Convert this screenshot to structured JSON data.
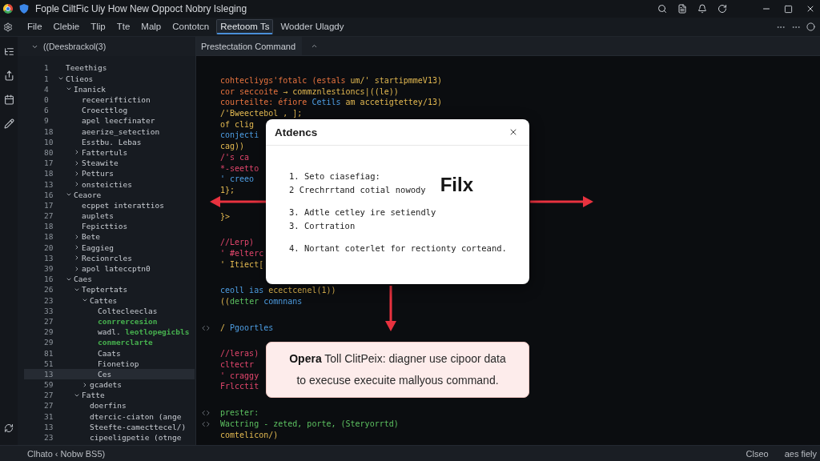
{
  "window": {
    "title": "Fople CiltFic Uiy How New Oppoct Nobry Isleging"
  },
  "menu": [
    {
      "label": "File",
      "selected": false
    },
    {
      "label": "Clebie",
      "selected": false
    },
    {
      "label": "Tlip",
      "selected": false
    },
    {
      "label": "Tte",
      "selected": false
    },
    {
      "label": "Malp",
      "selected": false
    },
    {
      "label": "Contotcn",
      "selected": false
    },
    {
      "label": "Reetoom Ts",
      "selected": true
    },
    {
      "label": "Wodder Ulagdy",
      "selected": false
    }
  ],
  "sidebar": {
    "header": "((Deesbrackol(3)",
    "expanded": true,
    "tree": [
      {
        "number": "1",
        "label": "Teeethigs",
        "selected": false
      },
      {
        "number": "1",
        "label": "Clieos",
        "expanded": true,
        "selected": false,
        "children": [
          {
            "number": "4",
            "label": "Inanick",
            "expanded": true,
            "selected": false,
            "children": [
              {
                "number": "0",
                "label": "receeriftiction",
                "selected": false
              },
              {
                "number": "6",
                "label": "Croecttlog",
                "selected": false
              },
              {
                "number": "9",
                "label": "apel leecfinater",
                "selected": false
              },
              {
                "number": "18",
                "label": "aeerize_setection",
                "selected": false
              },
              {
                "number": "10",
                "label": "Esstbu. Lebas",
                "selected": false
              },
              {
                "number": "80",
                "label": "Fattertuls",
                "expanded": false,
                "selected": false
              },
              {
                "number": "17",
                "label": "Steawite",
                "expanded": false,
                "selected": false
              },
              {
                "number": "18",
                "label": "Petturs",
                "expanded": false,
                "selected": false
              },
              {
                "number": "13",
                "label": "onsteicties",
                "expanded": false,
                "selected": false
              }
            ]
          },
          {
            "number": "16",
            "label": "Ceaore",
            "expanded": true,
            "selected": false,
            "children": [
              {
                "number": "17",
                "label": "ecppet interattios",
                "selected": false
              },
              {
                "number": "27",
                "label": "auplets",
                "selected": false
              },
              {
                "number": "18",
                "label": "Fepicttios",
                "selected": false
              },
              {
                "number": "18",
                "label": "Bete",
                "expanded": false,
                "selected": false
              },
              {
                "number": "20",
                "label": "Eaggieg",
                "expanded": false,
                "selected": false
              },
              {
                "number": "13",
                "label": "Recionrcles",
                "expanded": false,
                "selected": false
              },
              {
                "number": "39",
                "label": "apol lateccptn0",
                "expanded": false,
                "selected": false
              }
            ]
          },
          {
            "number": "16",
            "label": "Caes",
            "expanded": true,
            "selected": false,
            "children": [
              {
                "number": "26",
                "label": "Teptertats",
                "expanded": true,
                "selected": false,
                "children": [
                  {
                    "number": "23",
                    "label": "Cattes",
                    "expanded": true,
                    "selected": false,
                    "children": [
                      {
                        "number": "33",
                        "label": "Coltecleeclas",
                        "selected": false
                      },
                      {
                        "number": "27",
                        "label": "conrrercesion",
                        "color": "#46b04e",
                        "selected": false
                      },
                      {
                        "number": "29",
                        "prefix": "wadl.",
                        "label": "leotlopegicbls",
                        "color": "#46b04e",
                        "selected": false
                      },
                      {
                        "number": "29",
                        "label": "conmerclarte",
                        "color": "#46b04e",
                        "selected": false
                      },
                      {
                        "number": "81",
                        "label": "Caats",
                        "selected": false
                      },
                      {
                        "number": "51",
                        "label": "Fionetiop",
                        "selected": false
                      },
                      {
                        "number": "13",
                        "label": "Ces",
                        "selected": true
                      }
                    ]
                  },
                  {
                    "number": "59",
                    "label": "gcadets",
                    "expanded": false,
                    "selected": false
                  }
                ]
              },
              {
                "number": "27",
                "label": "Fatte",
                "expanded": true,
                "selected": false,
                "children": [
                  {
                    "number": "27",
                    "label": "doerfins",
                    "selected": false
                  },
                  {
                    "number": "31",
                    "label": "dtercic-ciaton (ange",
                    "selected": false
                  },
                  {
                    "number": "13",
                    "label": "Steefte-camecttecel/)",
                    "selected": false
                  },
                  {
                    "number": "23",
                    "label": "cipeeligpetie (otnge",
                    "selected": false
                  }
                ]
              }
            ]
          }
        ]
      }
    ]
  },
  "editor": {
    "tab": "Prestectation Command",
    "blocks": [
      {
        "lines": [
          {
            "segments": [
              {
                "text": "cohtecliygs'fotalc (estals ",
                "kind": "keyword"
              },
              {
                "text": "um/' startipmmeV13)",
                "kind": "string"
              }
            ]
          },
          {
            "segments": [
              {
                "text": "cor seccoite ",
                "kind": "keyword"
              },
              {
                "text": "→ commznlestioncs|((le))",
                "kind": "string"
              }
            ]
          },
          {
            "segments": [
              {
                "text": "courteilte: éfiore ",
                "kind": "keyword"
              },
              {
                "text": "Cetils ",
                "kind": "variable"
              },
              {
                "text": "am accetigtettey/13)",
                "kind": "string"
              }
            ]
          },
          {
            "segments": [
              {
                "text": "/'Bweectebol , ];",
                "kind": "string"
              }
            ]
          },
          {
            "segments": [
              {
                "text": "of clig",
                "kind": "string"
              }
            ]
          },
          {
            "segments": [
              {
                "text": "conjecti",
                "kind": "variable"
              }
            ]
          },
          {
            "segments": [
              {
                "text": "cag))",
                "kind": "string"
              }
            ]
          },
          {
            "segments": [
              {
                "text": "/'s ca",
                "kind": "comment"
              }
            ]
          },
          {
            "segments": [
              {
                "text": "*-seetto",
                "kind": "comment"
              }
            ]
          },
          {
            "segments": [
              {
                "text": "' creeo",
                "kind": "variable"
              }
            ]
          },
          {
            "segments": [
              {
                "text": "1};",
                "kind": "string"
              }
            ]
          }
        ]
      },
      {
        "lines": [
          {
            "segments": [
              {
                "text": "}>",
                "kind": "string"
              }
            ]
          }
        ]
      },
      {
        "lines": [
          {
            "segments": [
              {
                "text": "//Lerp)",
                "kind": "comment"
              }
            ]
          },
          {
            "segments": [
              {
                "text": "' #elterc",
                "kind": "comment"
              }
            ]
          },
          {
            "segments": [
              {
                "text": "' Itiect[",
                "kind": "string"
              }
            ]
          }
        ]
      },
      {
        "lines": [
          {
            "segments": [
              {
                "text": "ceoll ias ",
                "kind": "variable"
              },
              {
                "text": "ecectcenel(1))",
                "kind": "string"
              }
            ]
          },
          {
            "segments": [
              {
                "text": "((",
                "kind": "string"
              },
              {
                "text": "detter ",
                "kind": "function"
              },
              {
                "text": "comnnans",
                "kind": "variable"
              }
            ]
          }
        ]
      },
      {
        "lines": [
          {
            "marker": true,
            "segments": [
              {
                "text": "/ ",
                "kind": "string"
              },
              {
                "text": "Pgoortles",
                "kind": "variable"
              }
            ]
          }
        ]
      },
      {
        "lines": [
          {
            "segments": [
              {
                "text": "//leras)",
                "kind": "comment"
              }
            ]
          },
          {
            "segments": [
              {
                "text": "cltectr",
                "kind": "comment"
              }
            ]
          },
          {
            "segments": [
              {
                "text": "' craggy",
                "kind": "comment"
              }
            ]
          },
          {
            "segments": [
              {
                "text": "Frlcctit",
                "kind": "comment"
              }
            ]
          }
        ]
      },
      {
        "lines": [
          {
            "marker": true,
            "segments": [
              {
                "text": "prester:",
                "kind": "function"
              }
            ]
          },
          {
            "marker": true,
            "segments": [
              {
                "text": "Wactring - zeted, porte, (Steryorrtd)",
                "kind": "function"
              }
            ]
          },
          {
            "segments": [
              {
                "text": "comtelicon/)",
                "kind": "string"
              }
            ]
          }
        ]
      }
    ]
  },
  "dialog": {
    "title": "Atdencs",
    "groups": [
      {
        "tag": "Filx",
        "items": [
          {
            "number": "1.",
            "text": "Seto ciasefiag:"
          },
          {
            "number": "2",
            "text": "Crechrrtand cotial nowody"
          }
        ]
      },
      {
        "items": [
          {
            "number": "3.",
            "text": "Adtle cetley ire setiendly"
          },
          {
            "number": "3.",
            "text": "Cortration"
          }
        ]
      },
      {
        "items": [
          {
            "number": "4.",
            "text": "Nortant coterlet for rectionty corteand."
          }
        ]
      }
    ]
  },
  "callout": {
    "text": "**Opera** Toll ClitPeix: diagner use cipoor data to execuse execuite mallyous command."
  },
  "status_bar": {
    "left": "Clhato ‹ Nobw BS5)",
    "right": [
      "Clseo",
      "aes fiely"
    ]
  }
}
